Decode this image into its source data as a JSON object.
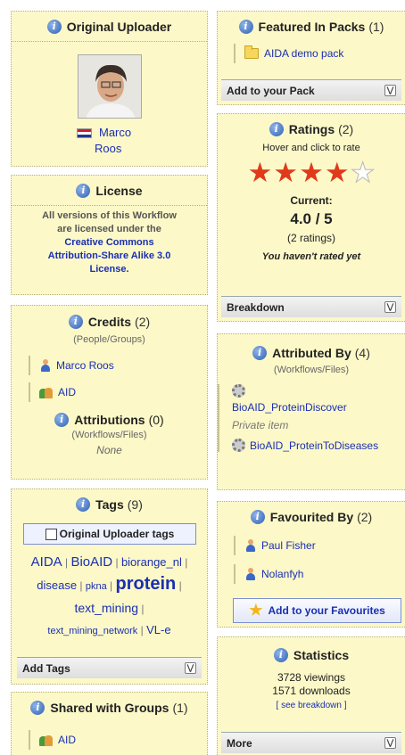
{
  "uploader": {
    "title": "Original Uploader",
    "flag_icon": "netherlands-flag-icon",
    "name_first": "Marco",
    "name_last": "Roos"
  },
  "license": {
    "title": "License",
    "line1": "All versions of this Workflow",
    "line2": "are licensed under the",
    "link1": "Creative Commons",
    "link2": "Attribution-Share Alike 3.0",
    "link3": "License."
  },
  "credits": {
    "title": "Credits",
    "count": "(2)",
    "subtitle": "(People/Groups)",
    "items": [
      {
        "label": "Marco Roos",
        "icon": "person-icon"
      },
      {
        "label": "AID",
        "icon": "group-icon"
      }
    ],
    "attributions_title": "Attributions",
    "attributions_count": "(0)",
    "attributions_subtitle": "(Workflows/Files)",
    "attributions_none": "None"
  },
  "tags": {
    "title": "Tags",
    "count": "(9)",
    "checkbox_label": "Original Uploader tags",
    "items": [
      "AIDA",
      "BioAID",
      "biorange_nl",
      "disease",
      "pkna",
      "protein",
      "text_mining",
      "text_mining_network",
      "VL-e"
    ],
    "footer": "Add Tags"
  },
  "shared": {
    "title": "Shared with Groups",
    "count": "(1)",
    "items": [
      {
        "label": "AID",
        "icon": "group-icon"
      }
    ]
  },
  "packs": {
    "title": "Featured In Packs",
    "count": "(1)",
    "items": [
      {
        "label": "AIDA demo pack",
        "icon": "folder-icon"
      }
    ],
    "footer": "Add to your Pack"
  },
  "ratings": {
    "title": "Ratings",
    "count": "(2)",
    "hint": "Hover and click to rate",
    "stars_filled": 4,
    "stars_total": 5,
    "current_label": "Current:",
    "current_value": "4.0 / 5",
    "num_ratings": "(2 ratings)",
    "not_rated": "You haven't rated yet",
    "footer": "Breakdown"
  },
  "attributed": {
    "title": "Attributed By",
    "count": "(4)",
    "subtitle": "(Workflows/Files)",
    "item1": "BioAID_ProteinDiscover",
    "private": "Private item",
    "item2": "BioAID_ProteinToDiseases"
  },
  "favourited": {
    "title": "Favourited By",
    "count": "(2)",
    "items": [
      {
        "label": "Paul Fisher",
        "icon": "person-icon"
      },
      {
        "label": "Nolanfyh",
        "icon": "person-icon"
      }
    ],
    "button": "Add to your Favourites"
  },
  "statistics": {
    "title": "Statistics",
    "viewings": "3728 viewings",
    "downloads": "1571 downloads",
    "breakdown_link": "[ see breakdown ]",
    "footer": "More"
  },
  "colors": {
    "panel_bg": "#fcf8c8",
    "link": "#1a2fb3",
    "star": "#e03a1a"
  }
}
